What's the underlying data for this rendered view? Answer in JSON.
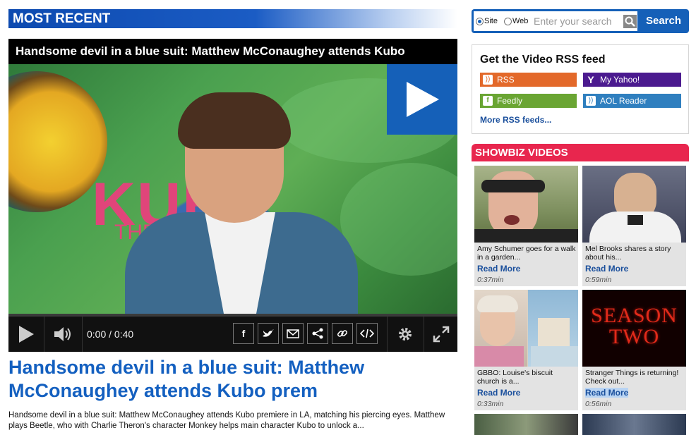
{
  "most_recent": {
    "label": "MOST RECENT"
  },
  "video": {
    "title": "Handsome devil in a blue suit: Matthew McConaughey attends Kubo",
    "frame_text_big": "KUB",
    "frame_text_small": "THE TWO",
    "time": "0:00 / 0:40",
    "share_icons": [
      "facebook-icon",
      "twitter-icon",
      "email-icon",
      "share-icon",
      "link-icon",
      "embed-icon"
    ]
  },
  "article": {
    "headline": "Handsome devil in a blue suit: Matthew McConaughey attends Kubo prem",
    "summary": "Handsome devil in a blue suit: Matthew McConaughey attends Kubo premiere in LA, matching his piercing eyes. Matthew plays Beetle, who with Charlie Theron's character Monkey helps main character Kubo to unlock a..."
  },
  "search": {
    "option_site": "Site",
    "option_web": "Web",
    "placeholder": "Enter your search",
    "button": "Search"
  },
  "rss": {
    "title": "Get the Video RSS feed",
    "buttons": [
      {
        "label": "RSS",
        "color": "#e3692a"
      },
      {
        "label": "My Yahoo!",
        "color": "#4b1a8f"
      },
      {
        "label": "Feedly",
        "color": "#6aa533"
      },
      {
        "label": "AOL Reader",
        "color": "#2f7fbf"
      }
    ],
    "more": "More RSS feeds..."
  },
  "showbiz": {
    "label": "SHOWBIZ VIDEOS",
    "read_more": "Read More",
    "items": [
      {
        "caption": "Amy Schumer goes for a walk in a garden...",
        "duration": "0:37min"
      },
      {
        "caption": "Mel Brooks shares a story about his...",
        "duration": "0:59min"
      },
      {
        "caption": "GBBO: Louise's biscuit church is a...",
        "duration": "0:33min"
      },
      {
        "caption": "Stranger Things is returning! Check out...",
        "duration": "0:56min",
        "thumb_text": "SEASON TWO"
      }
    ]
  }
}
